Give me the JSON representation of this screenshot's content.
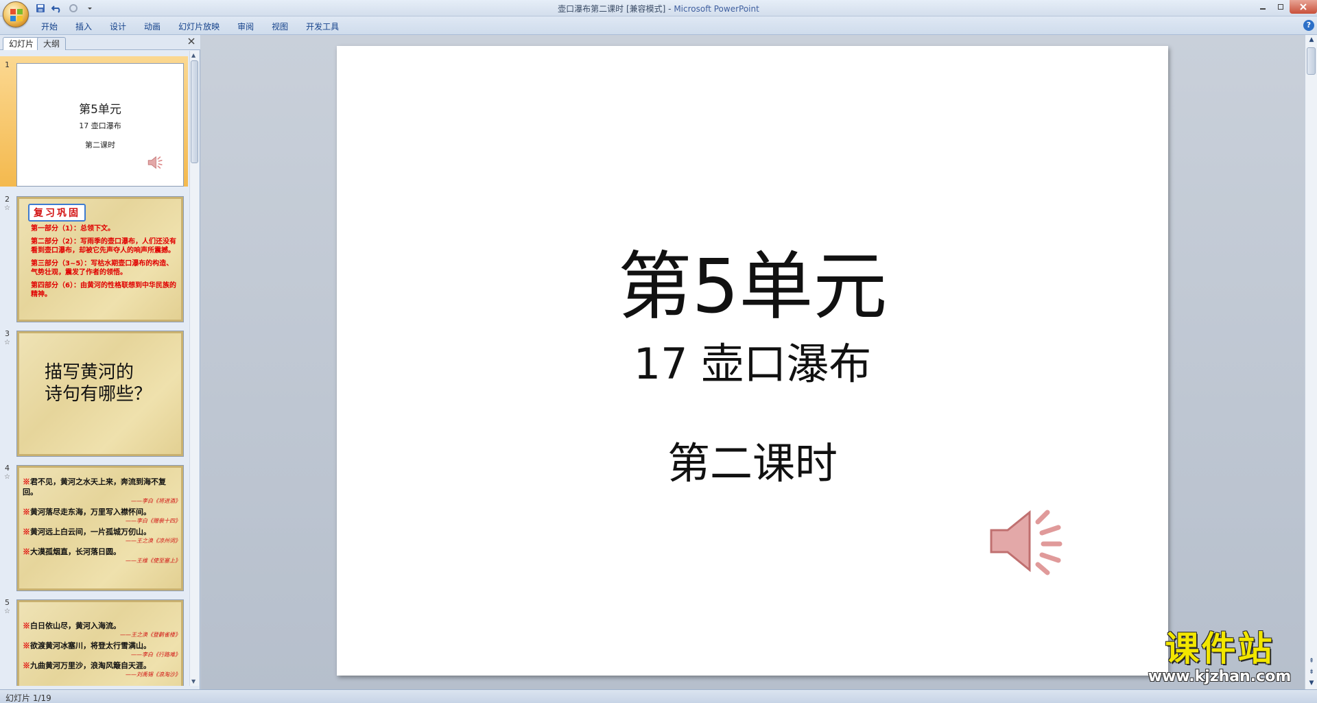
{
  "window": {
    "title_doc": "壶口瀑布第二课时 [兼容模式]",
    "title_sep": " - ",
    "title_app": "Microsoft PowerPoint"
  },
  "ribbon": {
    "tabs": [
      "开始",
      "插入",
      "设计",
      "动画",
      "幻灯片放映",
      "审阅",
      "视图",
      "开发工具"
    ]
  },
  "left_panel": {
    "tab_slides": "幻灯片",
    "tab_outline": "大纲"
  },
  "thumbnails": {
    "s1": {
      "num": "1",
      "title": "第5单元",
      "subtitle": "17  壶口瀑布",
      "lesson": "第二课时"
    },
    "s2": {
      "num": "2",
      "badge": "复习巩固",
      "lines": [
        "第一部分（1）：总领下文。",
        "第二部分（2）：写雨季的壶口瀑布，人们还没有看到壶口瀑布，却被它先声夺人的响声所震撼。",
        "第三部分（3~5）：写枯水期壶口瀑布的构造、气势壮观，震发了作者的领悟。",
        "第四部分（6）：由黄河的性格联想到中华民族的精神。"
      ]
    },
    "s3": {
      "num": "3",
      "line1": "描写黄河的",
      "line2": "诗句有哪些？"
    },
    "s4": {
      "num": "4",
      "poems": [
        {
          "text": "君不见，黄河之水天上来，奔流到海不复回。",
          "src": "——李白《将进酒》"
        },
        {
          "text": "黄河落尽走东海，万里写入襟怀间。",
          "src": "——李白《赠裴十四》"
        },
        {
          "text": "黄河远上白云间，一片孤城万仞山。",
          "src": "——王之涣《凉州词》"
        },
        {
          "text": "大漠孤烟直，长河落日圆。",
          "src": "——王维《使至塞上》"
        }
      ]
    },
    "s5": {
      "num": "5",
      "poems": [
        {
          "text": "白日依山尽，黄河入海流。",
          "src": "——王之涣《登鹳雀楼》"
        },
        {
          "text": "欲渡黄河冰塞川，将登太行雪满山。",
          "src": "——李白《行路难》"
        },
        {
          "text": "九曲黄河万里沙，浪淘风簸自天涯。",
          "src": "——刘禹锡《浪淘沙》"
        }
      ]
    },
    "mark": "※"
  },
  "slide": {
    "title": "第5单元",
    "subtitle": "17  壶口瀑布",
    "lesson": "第二课时"
  },
  "watermark": {
    "brand": "课件站",
    "url": "www.kjzhan.com"
  },
  "status": {
    "slide_counter": "幻灯片 1/19"
  },
  "icons": {
    "office": "office-logo-icon",
    "save": "save-icon",
    "undo": "undo-icon",
    "redo": "redo-icon",
    "customize": "qat-dropdown-icon",
    "speaker": "speaker-icon",
    "help": "help-icon"
  },
  "colors": {
    "selected_thumb": "#f4b94e",
    "accent_red": "#e00000",
    "watermark_yellow": "#f2e600"
  }
}
